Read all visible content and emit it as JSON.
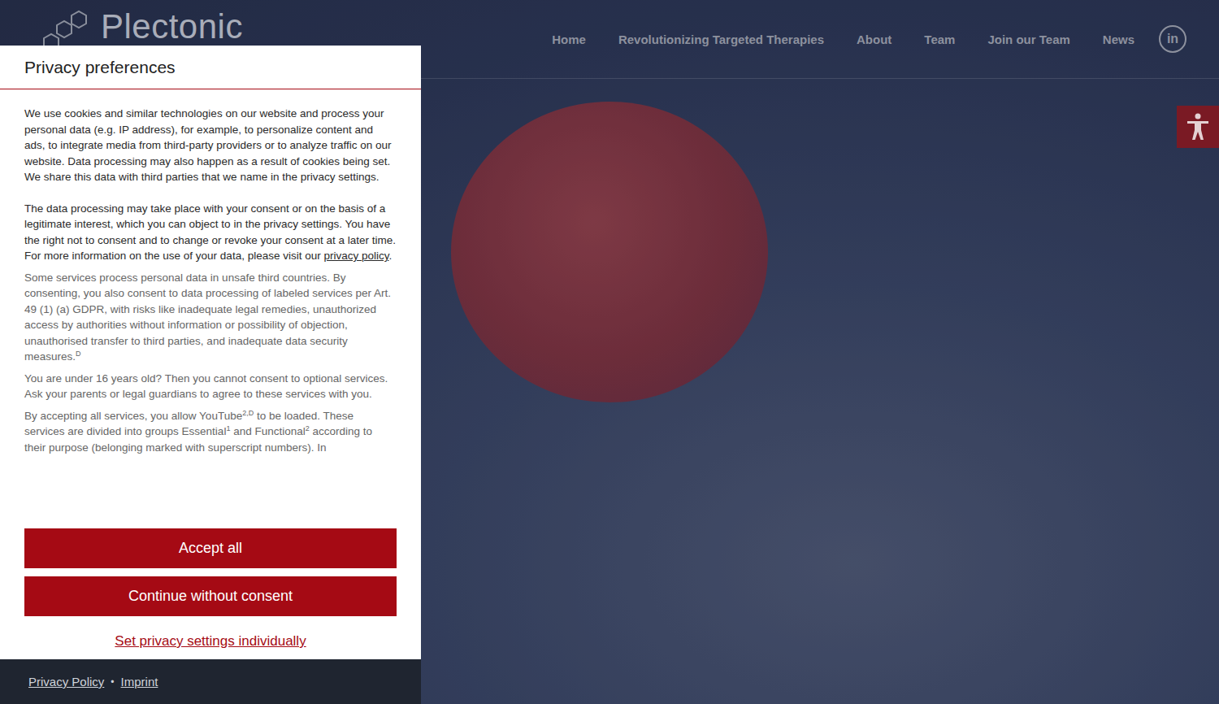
{
  "header": {
    "logo": "Plectonic",
    "nav": [
      {
        "label": "Home"
      },
      {
        "label": "Revolutionizing Targeted Therapies"
      },
      {
        "label": "About"
      },
      {
        "label": "Team"
      },
      {
        "label": "Join our Team"
      },
      {
        "label": "News"
      }
    ],
    "social": "in"
  },
  "consent": {
    "title": "Privacy preferences",
    "paragraphs": [
      {
        "kind": "main",
        "parts": [
          {
            "text": "We use cookies and similar technologies on our website and process your personal data (e.g. IP address), for example, to personalize content and ads, to integrate media from third-party providers or to analyze traffic on our website. Data processing may also happen as a result of cookies being set. We share this data with third parties that we name in the privacy settings.",
            "sup": "",
            "link": false
          }
        ]
      },
      {
        "kind": "main",
        "parts": [
          {
            "text": "The data processing may take place with your consent or on the basis of a legitimate interest, which you can object to in the privacy settings. You have the right not to consent and to change or revoke your consent at a later time. For more information on the use of your data, please visit our ",
            "sup": "",
            "link": false
          },
          {
            "text": "privacy policy",
            "sup": "",
            "link": true
          },
          {
            "text": ".",
            "sup": "",
            "link": false
          }
        ]
      },
      {
        "kind": "note",
        "parts": [
          {
            "text": "Some services process personal data in unsafe third countries. By consenting, you also consent to data processing of labeled services per Art. 49 (1) (a) GDPR, with risks like inadequate legal remedies, unauthorized access by authorities without information or possibility of objection, unauthorised transfer to third parties, and inadequate data security measures.",
            "sup": "D",
            "link": false
          }
        ]
      },
      {
        "kind": "note",
        "parts": [
          {
            "text": "You are under 16 years old? Then you cannot consent to optional services. Ask your parents or legal guardians to agree to these services with you.",
            "sup": "",
            "link": false
          }
        ]
      },
      {
        "kind": "note",
        "parts": [
          {
            "text": "By accepting all services, you allow YouTube",
            "sup": "2,D",
            "link": false
          },
          {
            "text": " to be loaded. These services are divided into groups Essential",
            "sup": "1",
            "link": false
          },
          {
            "text": " and Functional",
            "sup": "2",
            "link": false
          },
          {
            "text": " according to their purpose (belonging marked with superscript numbers). In",
            "sup": "",
            "link": false
          }
        ]
      }
    ],
    "buttons": [
      "Accept all",
      "Continue without consent"
    ],
    "link": "Set privacy settings individually",
    "footer_links": [
      "Privacy Policy",
      "Imprint"
    ],
    "separator": "•"
  }
}
